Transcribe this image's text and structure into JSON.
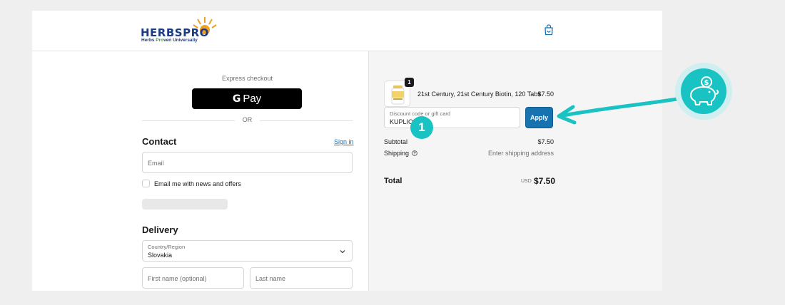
{
  "header": {
    "logo_name_a": "HERBS",
    "logo_name_b": "PRO",
    "logo_tag_a": "Herbs ",
    "logo_tag_b": "Pro",
    "logo_tag_c": "ven Universally",
    "cart_icon": "shopping-bag-icon"
  },
  "express": {
    "label": "Express checkout",
    "gpay_g": "G",
    "gpay_label": "Pay",
    "or": "OR"
  },
  "contact": {
    "title": "Contact",
    "signin": "Sign in",
    "email_placeholder": "Email",
    "newsletter_label": "Email me with news and offers"
  },
  "delivery": {
    "title": "Delivery",
    "country_label": "Country/Region",
    "country_value": "Slovakia",
    "first_name_placeholder": "First name (optional)",
    "last_name_placeholder": "Last name"
  },
  "order": {
    "quantity": "1",
    "product_name": "21st Century, 21st Century Biotin, 120 Tabs",
    "product_price": "$7.50",
    "discount_label": "Discount code or gift card",
    "discount_value": "KUPLIO",
    "apply_label": "Apply",
    "subtotal_label": "Subtotal",
    "subtotal_value": "$7.50",
    "shipping_label": "Shipping",
    "shipping_value": "Enter shipping address",
    "total_label": "Total",
    "total_currency": "USD",
    "total_value": "$7.50"
  },
  "overlay": {
    "step_number": "1",
    "piggy_icon": "piggy-bank-coin-icon",
    "accent_color": "#19c2c3"
  }
}
